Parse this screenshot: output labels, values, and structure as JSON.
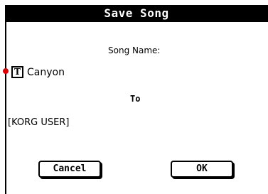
{
  "dialog": {
    "title": "Save Song",
    "song_name_label": "Song Name:",
    "text_edit_icon_glyph": "T",
    "song_name_value": "Canyon",
    "to_label": "To",
    "destination": "[KORG USER]",
    "cancel_label": "Cancel",
    "ok_label": "OK"
  },
  "colors": {
    "title_bar_bg": "#000000",
    "title_text": "#ffffff",
    "marker": "#e00000"
  },
  "icons": {
    "text_edit": "text-edit-icon",
    "marker": "selection-marker-dot"
  }
}
